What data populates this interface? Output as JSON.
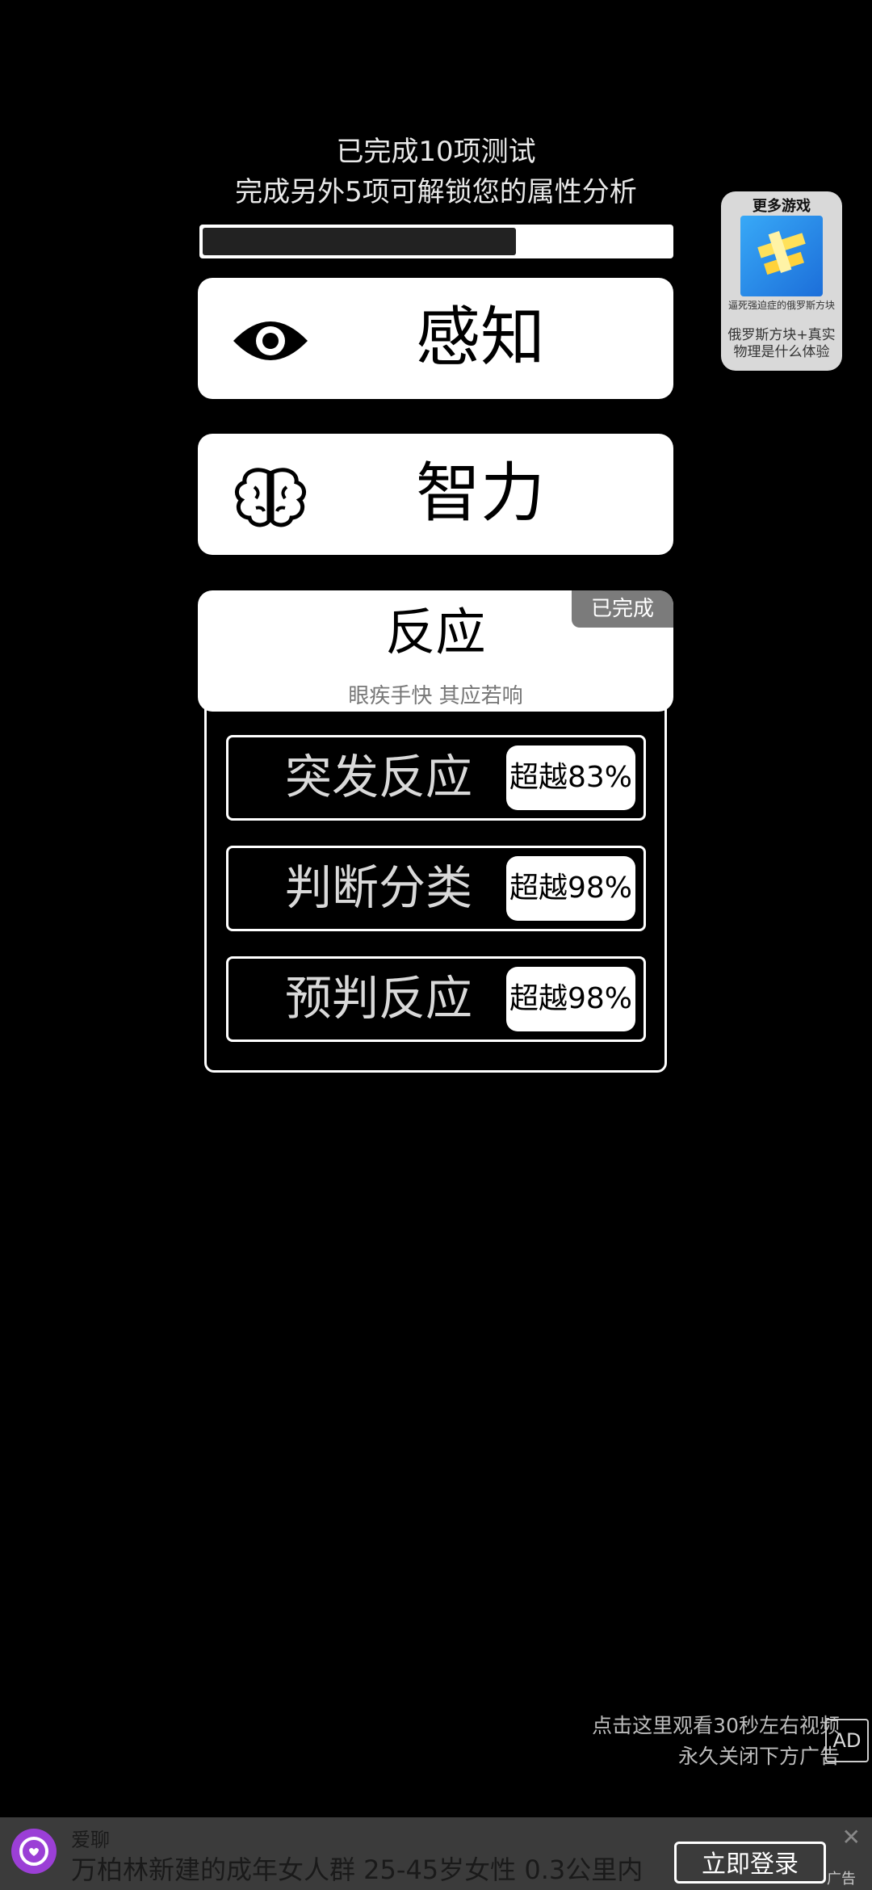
{
  "header": {
    "line1": "已完成10项测试",
    "line2": "完成另外5项可解锁您的属性分析",
    "progress_fraction": 0.67
  },
  "categories": [
    {
      "label": "感知",
      "icon": "eye-icon"
    },
    {
      "label": "智力",
      "icon": "brain-icon"
    },
    {
      "label": "反应",
      "subtitle": "眼疾手快 其应若响",
      "badge": "已完成"
    }
  ],
  "sub_tests": [
    {
      "label": "突发反应",
      "score": "超越83%"
    },
    {
      "label": "判断分类",
      "score": "超越98%"
    },
    {
      "label": "预判反应",
      "score": "超越98%"
    }
  ],
  "more_games": {
    "title": "更多游戏",
    "caption_small": "逼死强迫症的俄罗斯方块",
    "caption": "俄罗斯方块+真实物理是什么体验"
  },
  "ad_note": {
    "line1": "点击这里观看30秒左右视频",
    "line2": "永久关闭下方广告",
    "icon": "ad-block-icon"
  },
  "bottom_ad": {
    "brand": "爱聊",
    "headline": "万柏林新建的成年女人群 25-45岁女性 0.3公里内",
    "button": "立即登录",
    "tag": "广告",
    "close": "✕"
  },
  "colors": {
    "background": "#000000",
    "card": "#ffffff",
    "badge": "#7b7b7b",
    "ad_logo": "#9b3fd6"
  }
}
